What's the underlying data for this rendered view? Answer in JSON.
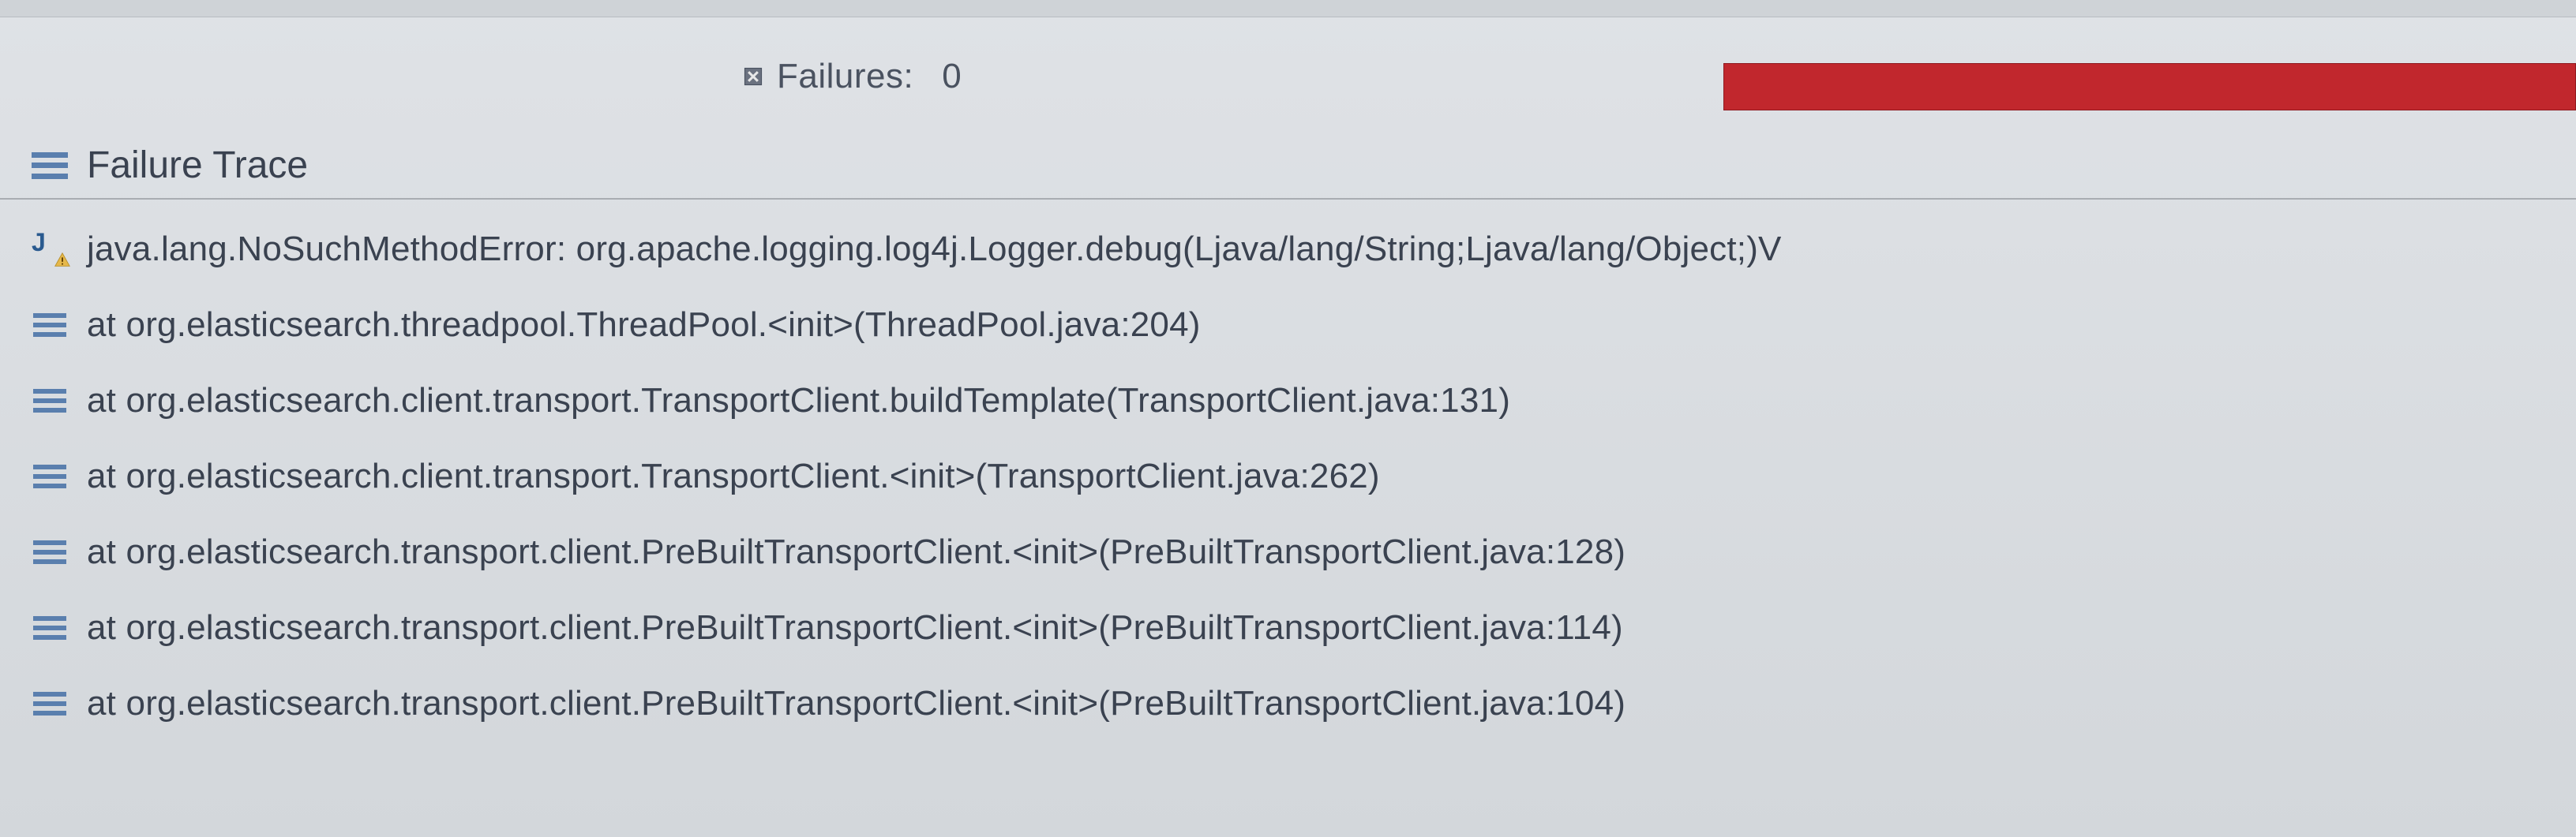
{
  "status": {
    "failures_label": "Failures:",
    "failures_count": "0"
  },
  "section": {
    "title": "Failure Trace"
  },
  "trace": {
    "exception": "java.lang.NoSuchMethodError: org.apache.logging.log4j.Logger.debug(Ljava/lang/String;Ljava/lang/Object;)V",
    "frames": [
      "at org.elasticsearch.threadpool.ThreadPool.<init>(ThreadPool.java:204)",
      "at org.elasticsearch.client.transport.TransportClient.buildTemplate(TransportClient.java:131)",
      "at org.elasticsearch.client.transport.TransportClient.<init>(TransportClient.java:262)",
      "at org.elasticsearch.transport.client.PreBuiltTransportClient.<init>(PreBuiltTransportClient.java:128)",
      "at org.elasticsearch.transport.client.PreBuiltTransportClient.<init>(PreBuiltTransportClient.java:114)",
      "at org.elasticsearch.transport.client.PreBuiltTransportClient.<init>(PreBuiltTransportClient.java:104)"
    ]
  }
}
